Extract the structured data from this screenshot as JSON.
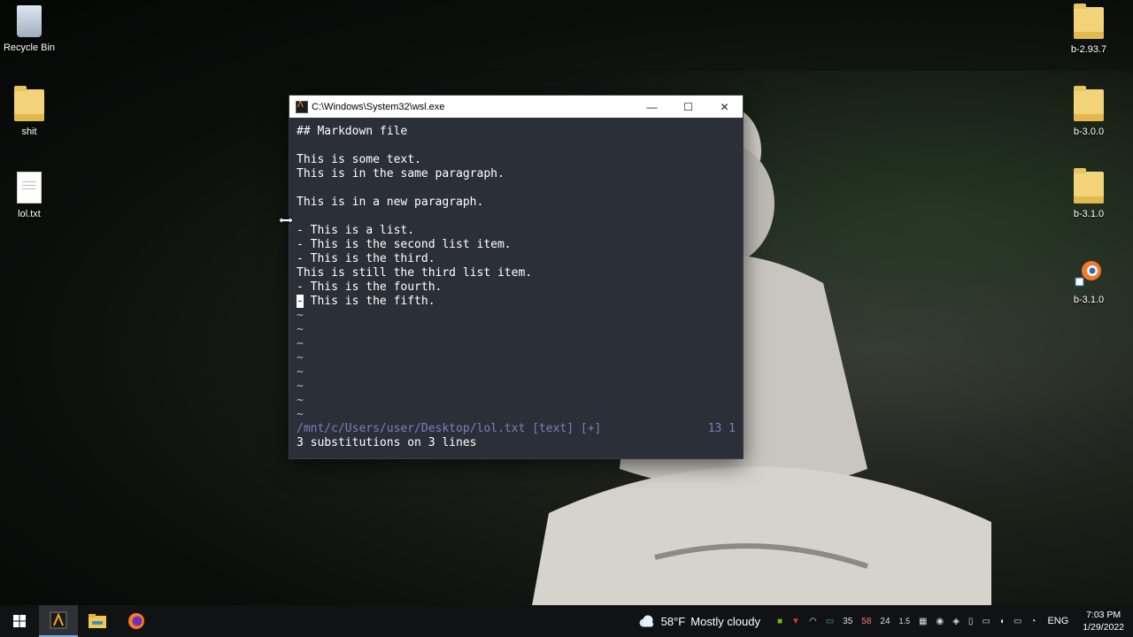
{
  "desktop": {
    "left_icons": [
      {
        "label": "Recycle Bin",
        "icon": "recycle-bin-icon"
      },
      {
        "label": "shit",
        "icon": "folder-icon"
      },
      {
        "label": "lol.txt",
        "icon": "text-file-icon"
      }
    ],
    "right_icons": [
      {
        "label": "b-2.93.7",
        "icon": "folder-icon"
      },
      {
        "label": "b-3.0.0",
        "icon": "folder-icon"
      },
      {
        "label": "b-3.1.0",
        "icon": "folder-icon"
      },
      {
        "label": "b-3.1.0",
        "icon": "blender-shortcut-icon"
      }
    ]
  },
  "window": {
    "title": "C:\\Windows\\System32\\wsl.exe",
    "buttons": {
      "minimize": "—",
      "maximize": "☐",
      "close": "✕"
    }
  },
  "editor": {
    "lines": [
      "## Markdown file",
      "",
      "This is some text.",
      "This is in the same paragraph.",
      "",
      "This is in a new paragraph.",
      "",
      "- This is a list.",
      "- This is the second list item.",
      "- This is the third.",
      "This is still the third list item.",
      "- This is the fourth.",
      "- This is the fifth."
    ],
    "cursor_char": "-",
    "cursor_rest": " This is the fifth.",
    "tilde": "~",
    "status_file": "/mnt/c/Users/user/Desktop/lol.txt [text] [+]",
    "status_pos": "13 1",
    "message": "3 substitutions on 3 lines"
  },
  "taskbar": {
    "weather_temp": "58°F",
    "weather_desc": "Mostly cloudy",
    "tray_values": [
      "35",
      "58",
      "24",
      "1.5"
    ],
    "language": "ENG",
    "time": "7:03 PM",
    "date": "1/29/2022"
  },
  "colors": {
    "terminal_bg": "#2b2f38",
    "status_fg": "#7d7fb8",
    "taskbar_bg": "#101214"
  }
}
